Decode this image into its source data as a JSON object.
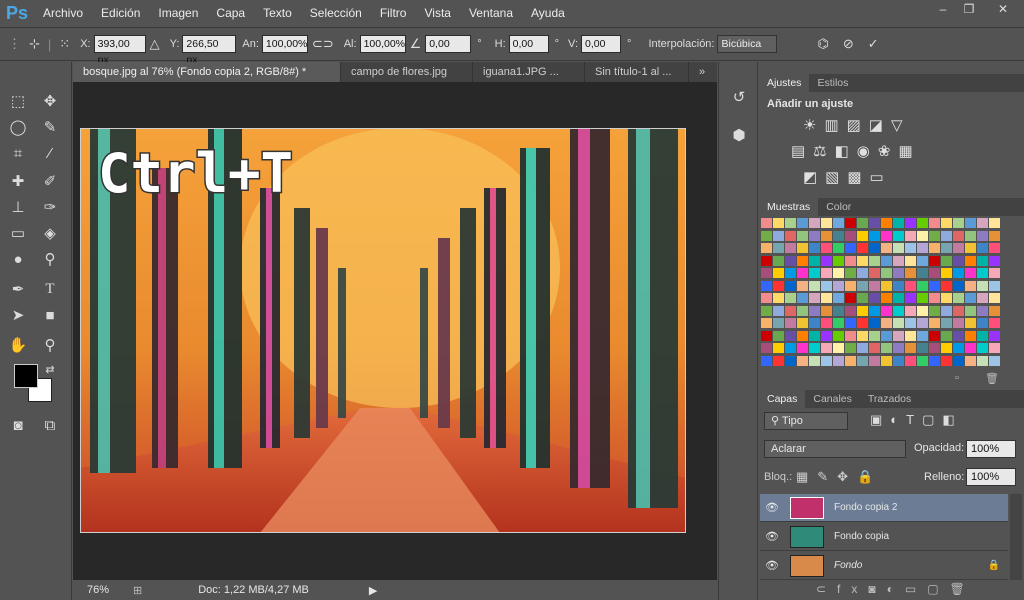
{
  "app": {
    "logo": "Ps"
  },
  "menu": [
    "Archivo",
    "Edición",
    "Imagen",
    "Capa",
    "Texto",
    "Selección",
    "Filtro",
    "Vista",
    "Ventana",
    "Ayuda"
  ],
  "window_controls": {
    "minimize": "–",
    "restore": "❐",
    "close": "✕"
  },
  "options": {
    "x_label": "X:",
    "x_value": "393,00 px",
    "y_label": "Y:",
    "y_value": "266,50 px",
    "w_label": "An:",
    "w_value": "100,00%",
    "h_label": "Al:",
    "h_value": "100,00%",
    "angle_value": "0,00",
    "angle_unit": "°",
    "hskew_label": "H:",
    "hskew_value": "0,00",
    "hskew_unit": "°",
    "vskew_label": "V:",
    "vskew_value": "0,00",
    "vskew_unit": "°",
    "interp_label": "Interpolación:",
    "interp_value": "Bicúbica"
  },
  "tabs": [
    {
      "label": "bosque.jpg al 76% (Fondo copia 2, RGB/8#) *",
      "active": true
    },
    {
      "label": "campo de flores.jpg",
      "active": false
    },
    {
      "label": "iguana1.JPG ...",
      "active": false
    },
    {
      "label": "Sin título-1 al ...",
      "active": false
    }
  ],
  "tabs_overflow": "»",
  "canvas_text": "Ctrl+T",
  "status": {
    "zoom": "76%",
    "doc": "Doc: 1,22 MB/4,27 MB"
  },
  "adjustments": {
    "tabs": [
      "Ajustes",
      "Estilos"
    ],
    "title": "Añadir un ajuste"
  },
  "swatches_panel": {
    "tabs": [
      "Muestras",
      "Color"
    ]
  },
  "layers_panel": {
    "tabs": [
      "Capas",
      "Canales",
      "Trazados"
    ],
    "filter_label": "Tipo",
    "blend_mode": "Aclarar",
    "opacity_label": "Opacidad:",
    "opacity_value": "100%",
    "lock_label": "Bloq.:",
    "fill_label": "Relleno:",
    "fill_value": "100%",
    "layers": [
      {
        "name": "Fondo copia 2",
        "selected": true,
        "locked": false
      },
      {
        "name": "Fondo copia",
        "selected": false,
        "locked": false
      },
      {
        "name": "Fondo",
        "selected": false,
        "locked": true
      }
    ]
  },
  "colors": {
    "accent": "#6a7f9c",
    "selection": "#6b7c94",
    "ps_blue": "#4aa8e8"
  }
}
